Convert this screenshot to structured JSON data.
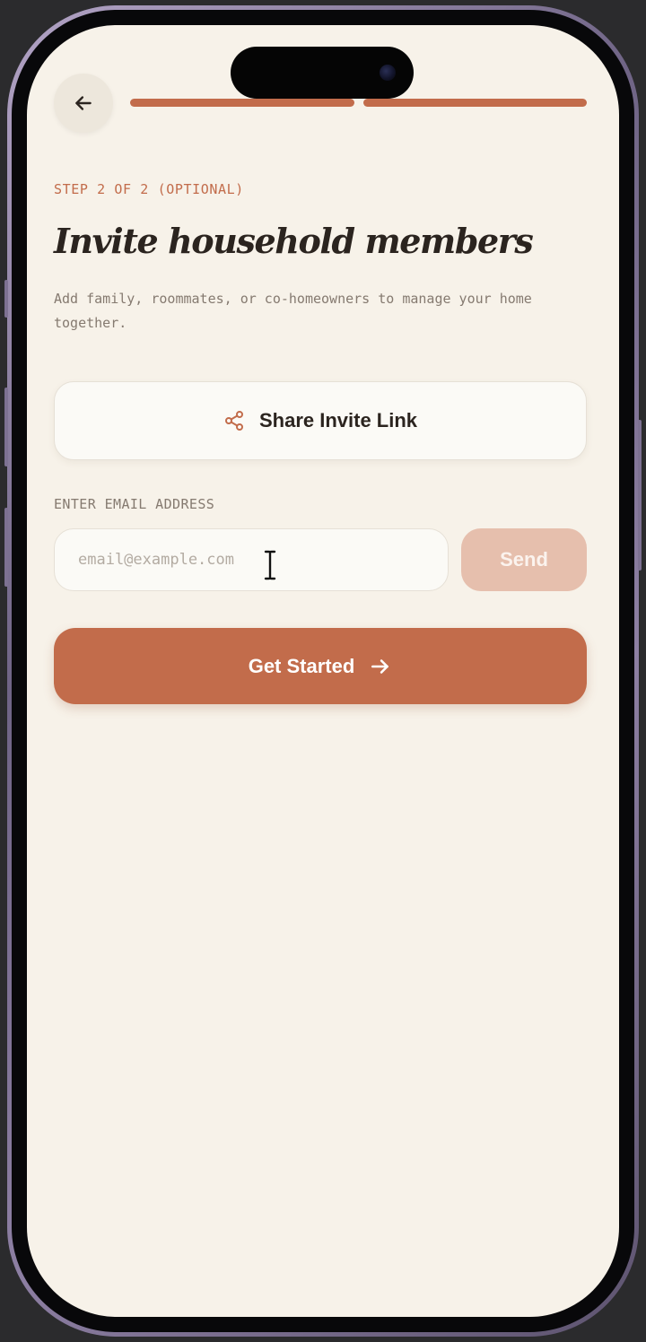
{
  "header": {
    "back_icon": "arrow-left-icon",
    "progress": {
      "current_step": 2,
      "total_steps": 2
    }
  },
  "onboarding": {
    "step_label": "STEP 2 OF 2 (OPTIONAL)",
    "title": "Invite household members",
    "subtitle": "Add family, roommates, or co-homeowners to manage your home together."
  },
  "share": {
    "icon": "share-icon",
    "label": "Share Invite Link"
  },
  "email": {
    "label": "ENTER EMAIL ADDRESS",
    "value": "",
    "placeholder": "email@example.com",
    "send_label": "Send"
  },
  "cta": {
    "label": "Get Started",
    "icon": "arrow-right-icon"
  },
  "colors": {
    "accent": "#c26c4b",
    "accent_disabled": "#e6bfad",
    "background": "#f7f2e9",
    "text_primary": "#2b241f",
    "text_muted": "#857a70"
  }
}
